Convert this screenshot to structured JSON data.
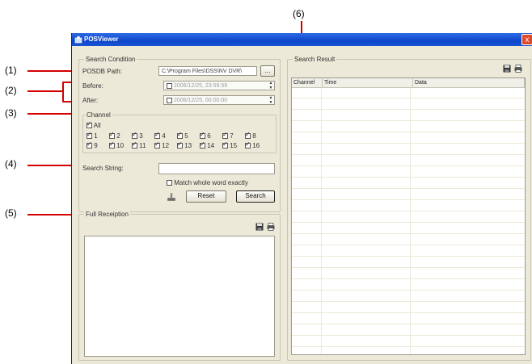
{
  "callouts": [
    "(1)",
    "(2)",
    "(3)",
    "(4)",
    "(5)",
    "(6)"
  ],
  "window": {
    "title": "POSViewer",
    "close": "x"
  },
  "search_condition": {
    "legend": "Search Condition",
    "posdb_label": "POSDB Path:",
    "posdb_value": "C:\\Program Files\\DSS\\NV DVR\\",
    "browse_label": "...",
    "before_label": "Before:",
    "before_value": "2006/12/25, 23:59:59",
    "after_label": "After:",
    "after_value": "2006/12/25, 00:00:00",
    "channel_legend": "Channel",
    "all_label": "All",
    "channels": [
      "1",
      "2",
      "3",
      "4",
      "5",
      "6",
      "7",
      "8",
      "9",
      "10",
      "11",
      "12",
      "13",
      "14",
      "15",
      "16"
    ],
    "search_string_label": "Search String:",
    "search_string_value": "",
    "match_label": "Match whole word exactly",
    "reset_label": "Reset",
    "search_label": "Search"
  },
  "full_reception": {
    "legend": "Full Receiption"
  },
  "search_result": {
    "legend": "Search Result",
    "columns": [
      "Channel",
      "Time",
      "Data"
    ]
  },
  "colors": {
    "accent": "#d40000",
    "titlebar": "#0d46c9",
    "window_bg": "#ece9d8"
  }
}
